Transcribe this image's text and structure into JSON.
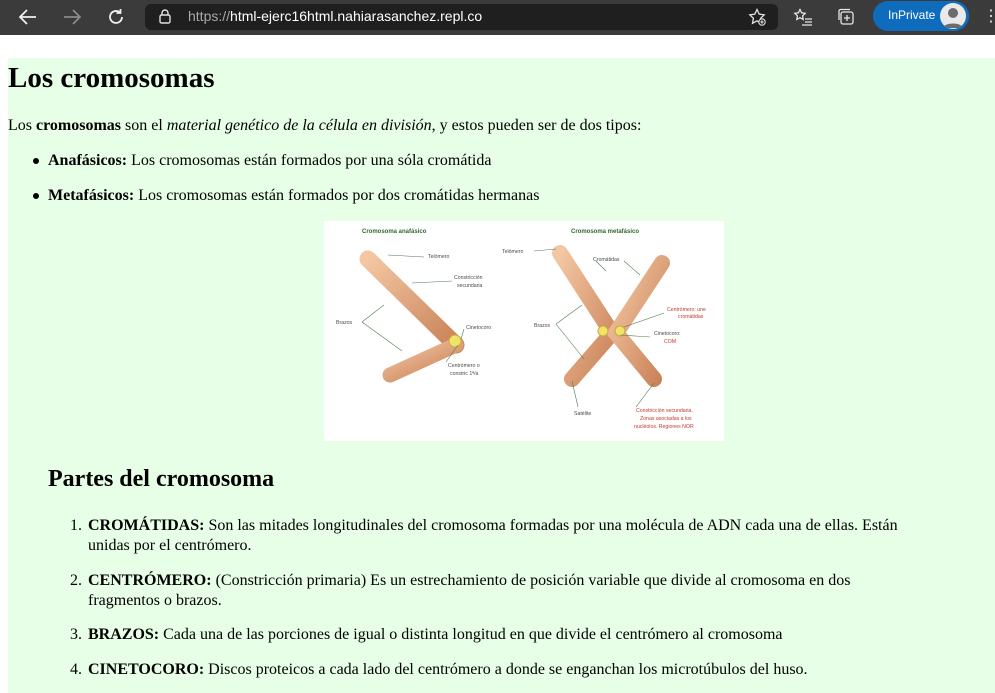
{
  "browser": {
    "url_scheme": "https://",
    "url_host": "html-ejerc16html.nahiarasanchez.repl.co",
    "inprivate_label": "InPrivate"
  },
  "article": {
    "title": "Los cromosomas",
    "intro": {
      "pre": "Los ",
      "strong": "cromosomas",
      "mid": " son el ",
      "em": "material genético de la célula en división",
      "post": ", y estos pueden ser de dos tipos:"
    },
    "types": [
      {
        "term": "Anafásicos:",
        "text": " Los cromosomas están formados por una sóla cromátida"
      },
      {
        "term": "Metafásicos:",
        "text": " Los cromosomas están formados por dos cromátidas hermanas"
      }
    ],
    "figure": {
      "left_title": "Cromosoma anafásico",
      "right_title": "Cromosoma metafásico",
      "labels": {
        "telomero_l": "Telómero",
        "constriccion_l1": "Constricción",
        "constriccion_l2": "secundaria",
        "brazos_l": "Brazos",
        "cinetocoro_l": "Cinetocoro",
        "centromero_l1": "Centrómero o",
        "centromero_l2": "constric 1ª/a",
        "telomero_r": "Telómero",
        "cromatidas_r": "Cromátidas",
        "brazos_r": "Brazos",
        "centromero_r1": "Centrómero: une",
        "centromero_r2": "cromátidas",
        "cinetocoro_r1": "Cinetocoro:",
        "cinetocoro_r2": "COM",
        "satelite_r": "Satélite",
        "constric_r1": "Constricción secundaria.",
        "constric_r2": "Zonas asociadas a los",
        "constric_r3": "nucléolos. Regiones NOR"
      }
    },
    "section_title": "Partes del cromosoma",
    "parts": [
      {
        "num": "1.",
        "term": "CROMÁTIDAS:",
        "line1": " Son las mitades longitudinales del cromosoma formadas por una molécula de ADN cada una de ellas. Están",
        "line2": "unidas por el centrómero."
      },
      {
        "num": "2.",
        "term": "CENTRÓMERO:",
        "line1": " (Constricción primaria) Es un estrechamiento de posición variable que divide al cromosoma en dos",
        "line2": "fragmentos o brazos."
      },
      {
        "num": "3.",
        "term": "BRAZOS:",
        "line1": " Cada una de las porciones de igual o distinta longitud en que divide el centrómero al cromosoma",
        "line2": ""
      },
      {
        "num": "4.",
        "term": "CINETOCORO:",
        "line1": " Discos proteicos a cada lado del centrómero a donde se enganchan los microtúbulos del huso.",
        "line2": ""
      }
    ]
  }
}
